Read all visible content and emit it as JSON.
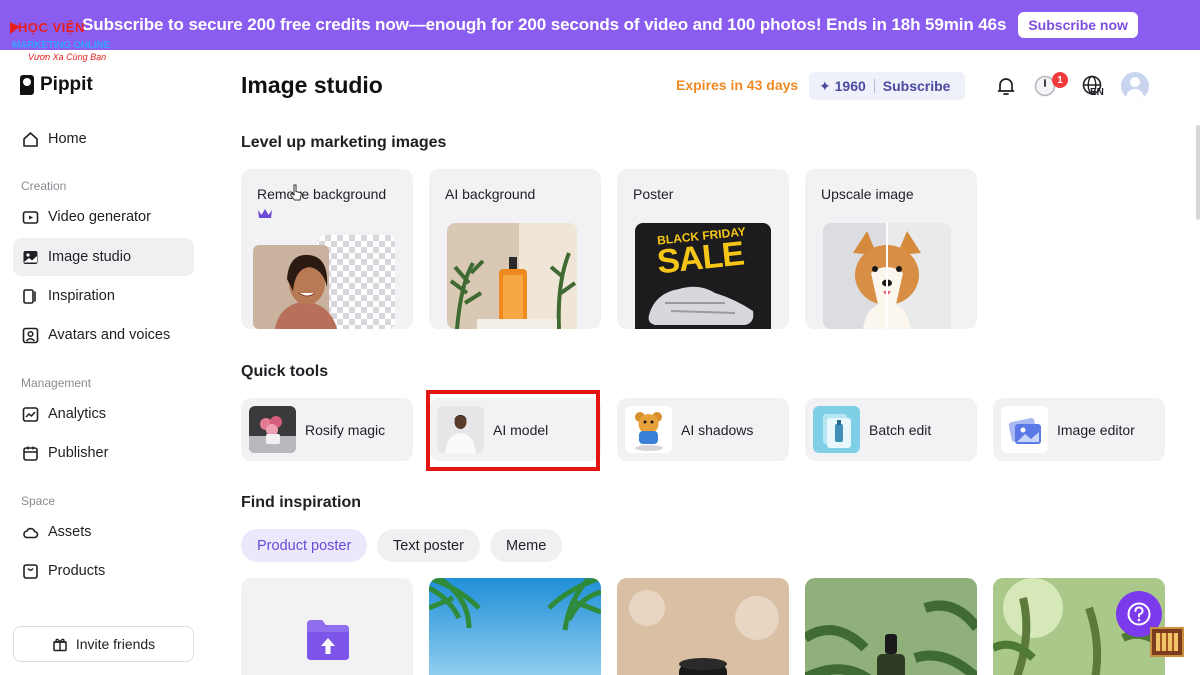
{
  "banner": {
    "text": "Subscribe to secure 200 free credits now—enough for 200 seconds of video and 100 photos! Ends in 18h 59min 46s",
    "button": "Subscribe now"
  },
  "watermark": {
    "line1": "HỌC VIỆN",
    "line2": "MARKETING ONLINE",
    "line3": "Vươn Xa Cùng Bạn"
  },
  "app": {
    "logo": "Pippit"
  },
  "sidebar": {
    "home": "Home",
    "creation_label": "Creation",
    "creation": [
      {
        "label": "Video generator",
        "icon": "video-icon"
      },
      {
        "label": "Image studio",
        "icon": "image-icon",
        "active": true
      },
      {
        "label": "Inspiration",
        "icon": "inspiration-icon"
      },
      {
        "label": "Avatars and voices",
        "icon": "avatar-icon"
      }
    ],
    "management_label": "Management",
    "management": [
      {
        "label": "Analytics",
        "icon": "analytics-icon"
      },
      {
        "label": "Publisher",
        "icon": "calendar-icon"
      }
    ],
    "space_label": "Space",
    "space": [
      {
        "label": "Assets",
        "icon": "cloud-icon"
      },
      {
        "label": "Products",
        "icon": "bag-icon"
      }
    ],
    "invite": "Invite friends"
  },
  "header": {
    "title": "Image studio",
    "expires": "Expires in 43 days",
    "credits": "✦ 1960",
    "subscribe": "Subscribe",
    "notification_badge": "1",
    "language": "EN"
  },
  "sections": {
    "level_up": "Level up marketing images",
    "quick_tools": "Quick tools",
    "find_inspiration": "Find inspiration"
  },
  "feature_cards": [
    {
      "label": "Remove background"
    },
    {
      "label": "AI background"
    },
    {
      "label": "Poster",
      "poster_line1": "BLACK FRIDAY",
      "poster_line2": "SALE"
    },
    {
      "label": "Upscale image"
    }
  ],
  "quick_tools": [
    {
      "label": "Rosify magic"
    },
    {
      "label": "AI model"
    },
    {
      "label": "AI shadows"
    },
    {
      "label": "Batch edit"
    },
    {
      "label": "Image editor"
    }
  ],
  "inspiration_chips": [
    {
      "label": "Product poster",
      "active": true
    },
    {
      "label": "Text poster"
    },
    {
      "label": "Meme"
    }
  ],
  "colors": {
    "banner": "#8b5cf0",
    "accent": "#7c3aed",
    "expires": "#f08a24",
    "highlight": "#e31414"
  }
}
